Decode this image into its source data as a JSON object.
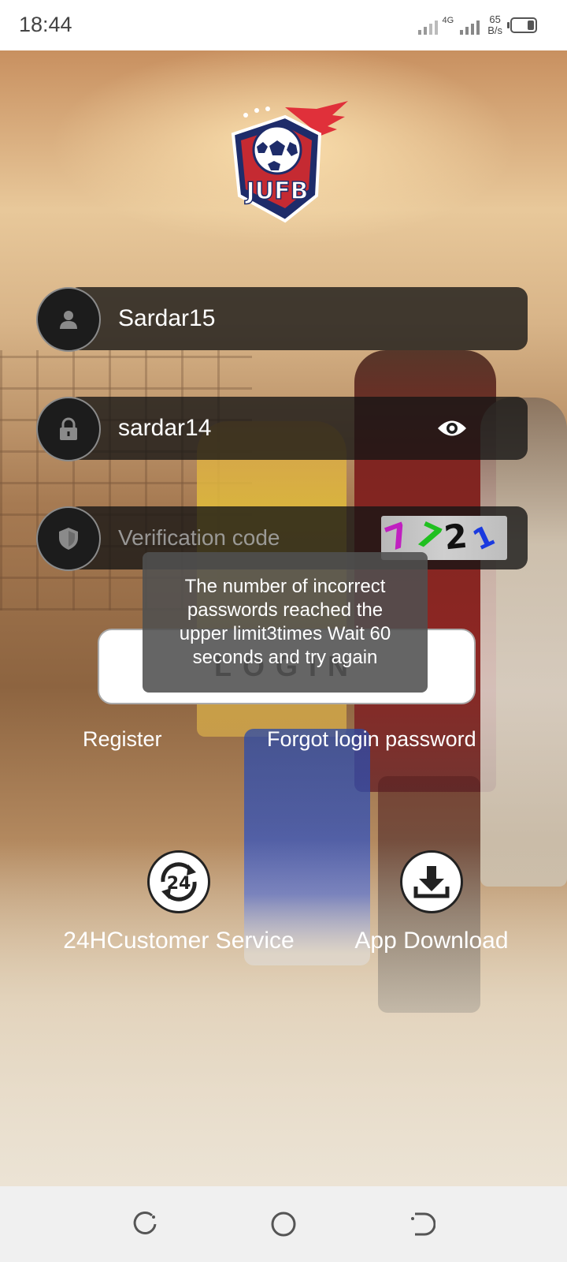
{
  "status_bar": {
    "time": "18:44",
    "network": "4G",
    "speed_value": "65",
    "speed_unit": "B/s"
  },
  "logo": {
    "text": "JUFB"
  },
  "form": {
    "username_value": "Sardar15",
    "password_value": "sardar14",
    "verification_placeholder": "Verification code",
    "captcha_chars": [
      "7",
      "7",
      "2",
      "1"
    ],
    "login_label": "LOGIN"
  },
  "toast": {
    "message": "The number of incorrect passwords reached the upper limit3times Wait 60 seconds and try again"
  },
  "links": {
    "register": "Register",
    "forgot": "Forgot login password"
  },
  "actions": {
    "customer_service": "24HCustomer Service",
    "customer_service_icon_text": "24",
    "app_download": "App Download"
  },
  "colors": {
    "field_bg": "#1c1c1c",
    "captcha_1": "#c020c0",
    "captcha_2": "#20c020",
    "captcha_3": "#111111",
    "captcha_4": "#1a3adf"
  }
}
